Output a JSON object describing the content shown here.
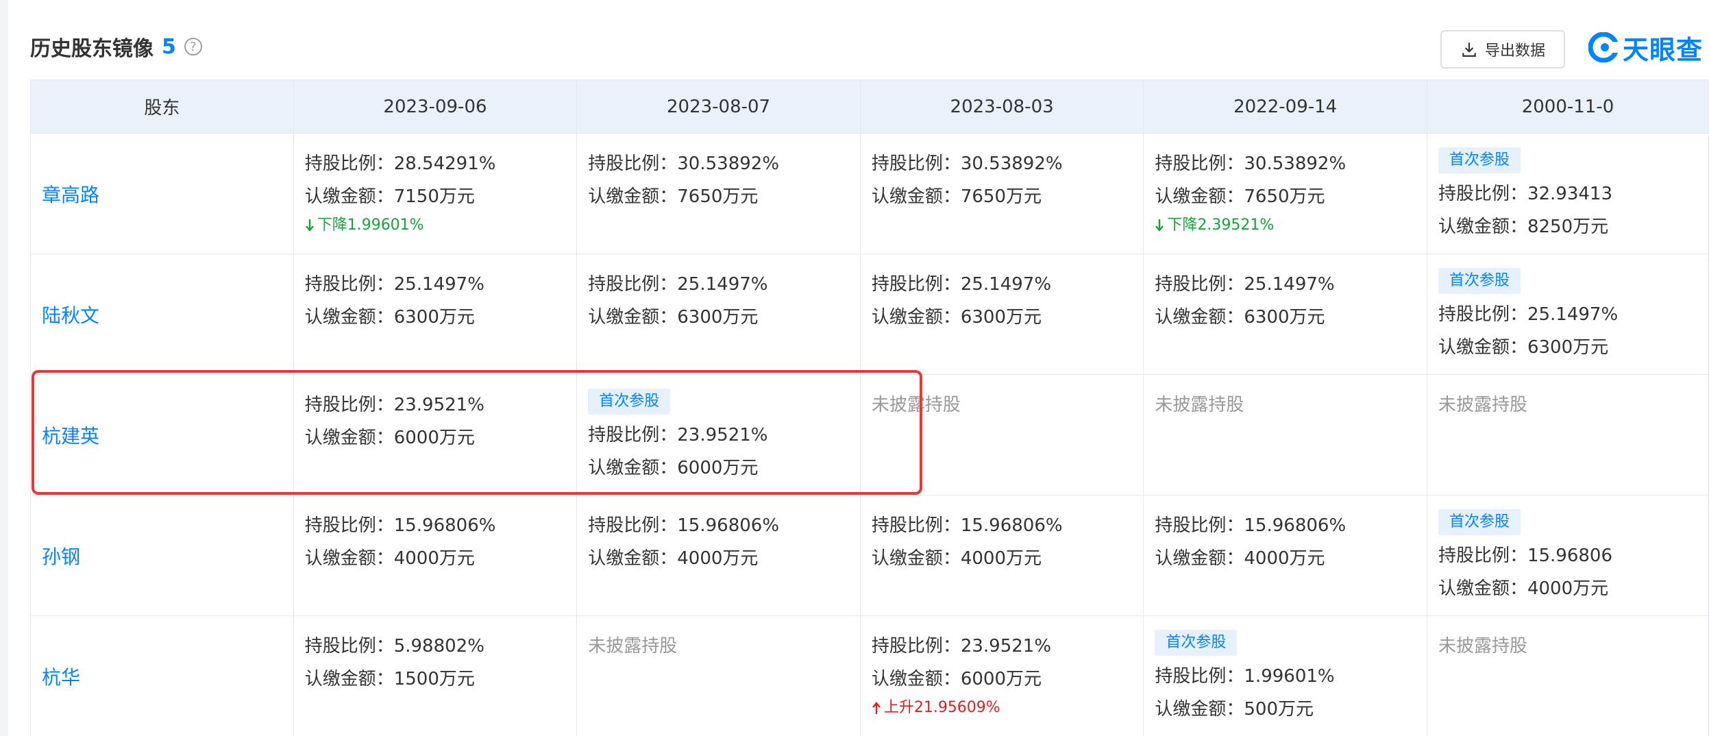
{
  "header": {
    "title": "历史股东镜像",
    "count": "5",
    "help_icon": "question-circle-icon"
  },
  "toolbar": {
    "export_label": "导出数据",
    "export_icon": "download-icon"
  },
  "brand": {
    "name": "天眼查",
    "logo_icon": "tianyancha-logo-icon",
    "color": "#0084ff"
  },
  "table": {
    "shareholder_header": "股东",
    "dates": [
      "2023-09-06",
      "2023-08-07",
      "2023-08-03",
      "2022-09-14",
      "2000-11-0"
    ],
    "rows": [
      {
        "name": "章高路",
        "cells": [
          {
            "ratio": "持股比例：28.54291%",
            "amount": "认缴金额：7150万元",
            "change": "下降1.99601%"
          },
          {
            "ratio": "持股比例：30.53892%",
            "amount": "认缴金额：7650万元"
          },
          {
            "ratio": "持股比例：30.53892%",
            "amount": "认缴金额：7650万元"
          },
          {
            "ratio": "持股比例：30.53892%",
            "amount": "认缴金额：7650万元",
            "change": "下降2.39521%"
          },
          {
            "badge": "首次参股",
            "ratio": "持股比例：32.93413",
            "amount": "认缴金额：8250万元"
          }
        ]
      },
      {
        "name": "陆秋文",
        "cells": [
          {
            "ratio": "持股比例：25.1497%",
            "amount": "认缴金额：6300万元"
          },
          {
            "ratio": "持股比例：25.1497%",
            "amount": "认缴金额：6300万元"
          },
          {
            "ratio": "持股比例：25.1497%",
            "amount": "认缴金额：6300万元"
          },
          {
            "ratio": "持股比例：25.1497%",
            "amount": "认缴金额：6300万元"
          },
          {
            "badge": "首次参股",
            "ratio": "持股比例：25.1497%",
            "amount": "认缴金额：6300万元"
          }
        ]
      },
      {
        "name": "杭建英",
        "cells": [
          {
            "ratio": "持股比例：23.9521%",
            "amount": "认缴金额：6000万元"
          },
          {
            "badge": "首次参股",
            "ratio": "持股比例：23.9521%",
            "amount": "认缴金额：6000万元"
          },
          {
            "undisclosed": "未披露持股"
          },
          {
            "undisclosed": "未披露持股"
          },
          {
            "undisclosed": "未披露持股"
          }
        ]
      },
      {
        "name": "孙钢",
        "cells": [
          {
            "ratio": "持股比例：15.96806%",
            "amount": "认缴金额：4000万元"
          },
          {
            "ratio": "持股比例：15.96806%",
            "amount": "认缴金额：4000万元"
          },
          {
            "ratio": "持股比例：15.96806%",
            "amount": "认缴金额：4000万元"
          },
          {
            "ratio": "持股比例：15.96806%",
            "amount": "认缴金额：4000万元"
          },
          {
            "badge": "首次参股",
            "ratio": "持股比例：15.96806",
            "amount": "认缴金额：4000万元"
          }
        ]
      },
      {
        "name": "杭华",
        "cells": [
          {
            "ratio": "持股比例：5.98802%",
            "amount": "认缴金额：1500万元"
          },
          {
            "undisclosed": "未披露持股"
          },
          {
            "ratio": "持股比例：23.9521%",
            "amount": "认缴金额：6000万元",
            "change_up": "上升21.95609%"
          },
          {
            "badge": "首次参股",
            "ratio": "持股比例：1.99601%",
            "amount": "认缴金额：500万元"
          },
          {
            "undisclosed": "未披露持股"
          }
        ]
      }
    ]
  },
  "colors": {
    "accent": "#0084ff",
    "down": "#13a538",
    "up": "#e02020",
    "highlight": "#e53935",
    "header_bg": "#eaf1fb"
  }
}
